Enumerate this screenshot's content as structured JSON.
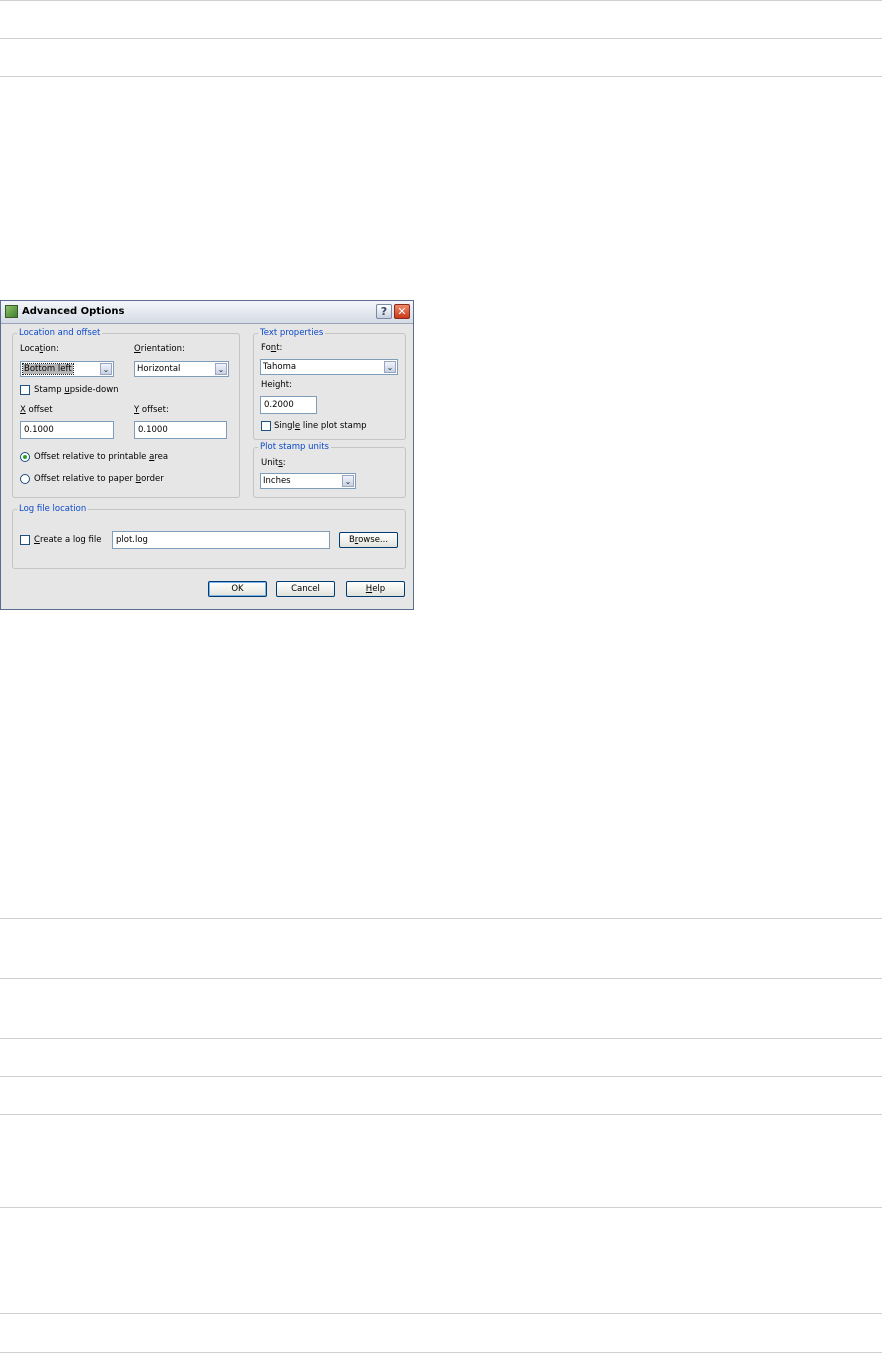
{
  "dialog": {
    "title": "Advanced Options",
    "help_glyph": "?",
    "close_glyph": "✕"
  },
  "location_offset": {
    "legend": "Location and offset",
    "location_label": [
      "Loca",
      "t",
      "ion:"
    ],
    "location_value": "Bottom left",
    "orientation_label": [
      "",
      "O",
      "rientation:"
    ],
    "orientation_value": "Horizontal",
    "stamp_upside_down_label": [
      "Stamp ",
      "u",
      "pside-down"
    ],
    "stamp_upside_down_checked": false,
    "x_offset_label": [
      "",
      "X",
      " offset"
    ],
    "x_offset_value": "0.1000",
    "y_offset_label": [
      "",
      "Y",
      " offset:"
    ],
    "y_offset_value": "0.1000",
    "radio_printable_label": [
      "Offset relative to printable ",
      "a",
      "rea"
    ],
    "radio_printable_selected": true,
    "radio_paper_label": [
      "Offset relative to paper ",
      "b",
      "order"
    ],
    "radio_paper_selected": false
  },
  "text_properties": {
    "legend": "Text properties",
    "font_label": [
      "Fo",
      "n",
      "t:"
    ],
    "font_value": "Tahoma",
    "height_label": [
      "Height",
      "",
      ":"
    ],
    "height_value": "0.2000",
    "single_line_label": [
      "Singl",
      "e",
      " line plot stamp"
    ],
    "single_line_checked": false
  },
  "plot_stamp_units": {
    "legend": "Plot stamp units",
    "units_label": [
      "Unit",
      "s",
      ":"
    ],
    "units_value": "Inches"
  },
  "log_file": {
    "legend": "Log file location",
    "create_label": [
      "",
      "C",
      "reate a log file"
    ],
    "create_checked": false,
    "path_value": "plot.log",
    "browse_label": [
      "B",
      "r",
      "owse..."
    ]
  },
  "footer": {
    "ok_label": "OK",
    "cancel_label": "Cancel",
    "help_label": [
      "",
      "H",
      "elp"
    ]
  },
  "icons": {
    "dropdown_arrow": "⌄",
    "app_icon": "plot-stamp-app-icon"
  }
}
